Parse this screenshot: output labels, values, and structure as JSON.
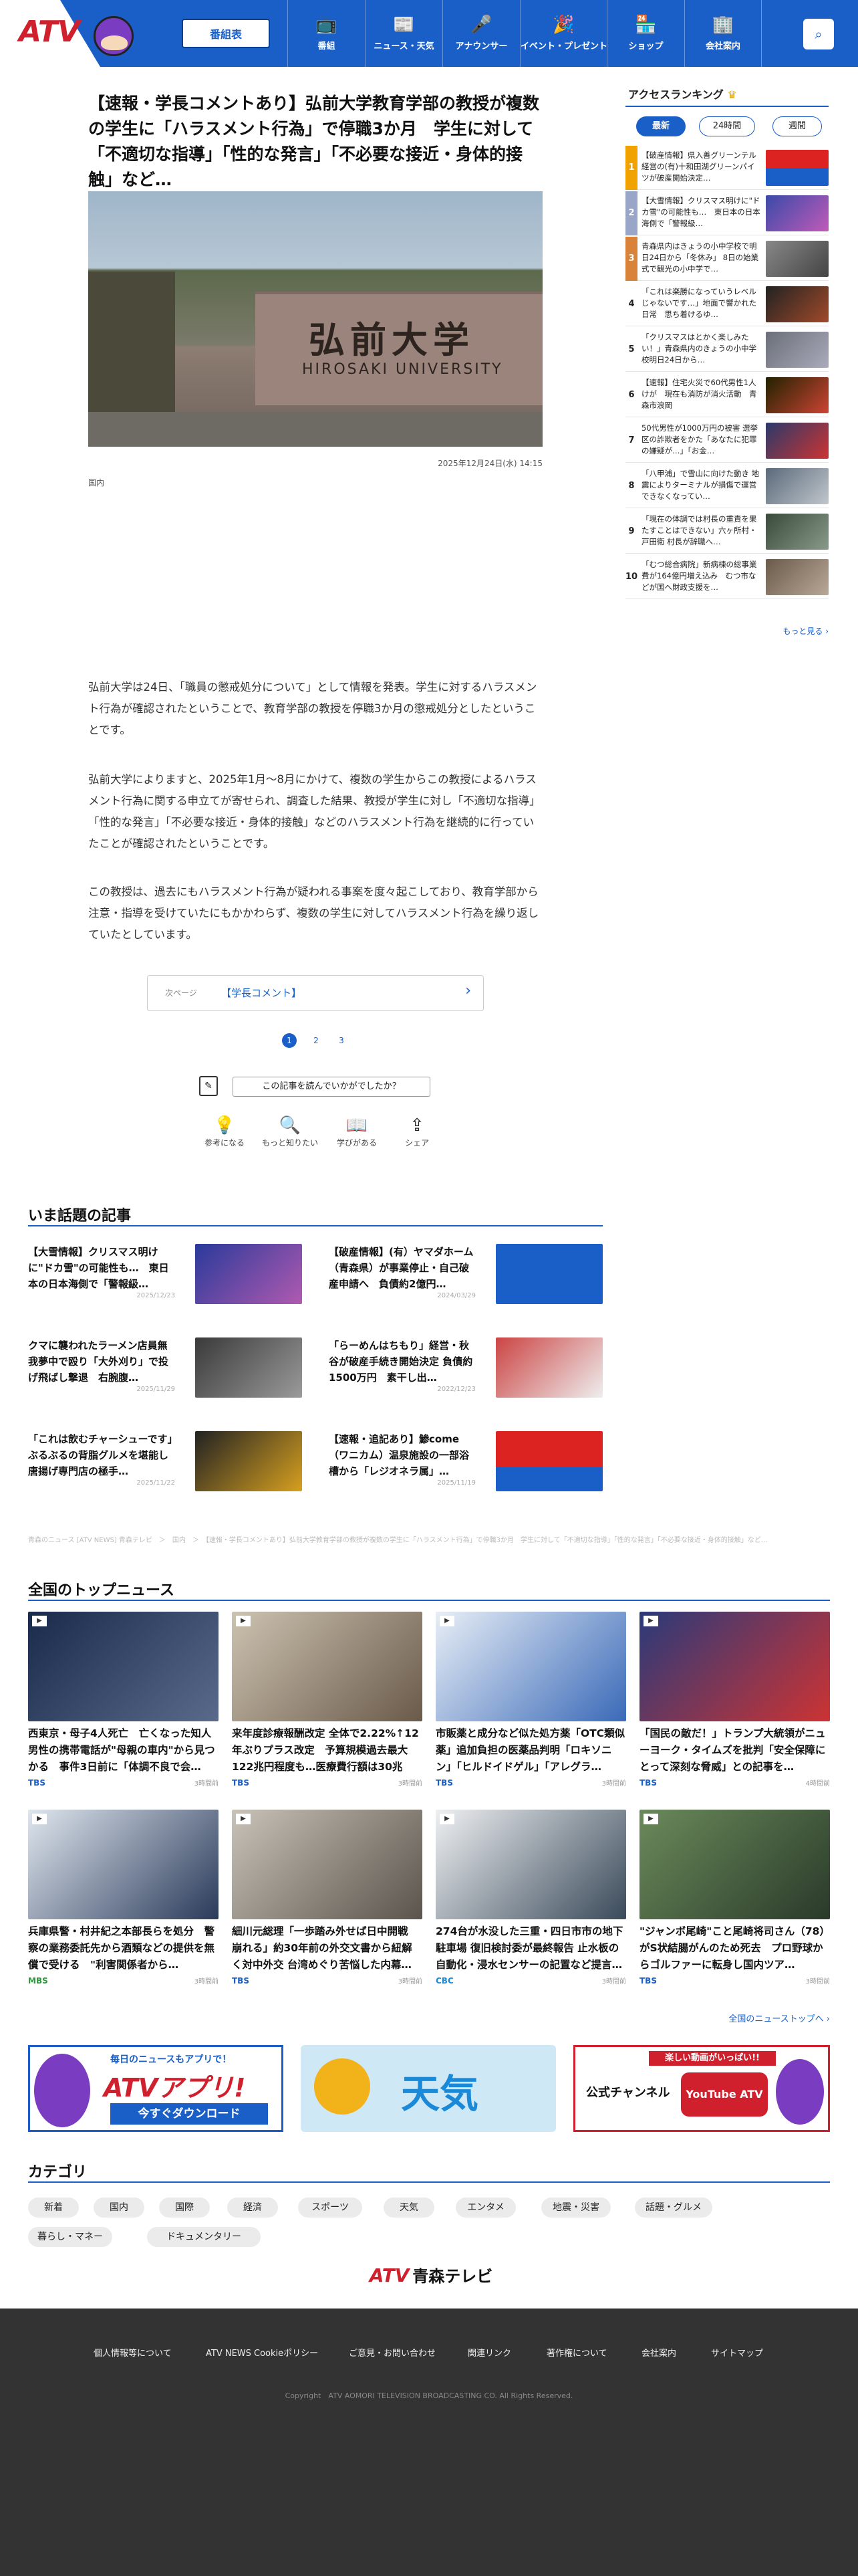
{
  "header": {
    "logo": "ATV",
    "program_button": "番組表",
    "nav": [
      {
        "label": "番組",
        "icon": "tv-icon"
      },
      {
        "label": "ニュース・天気",
        "icon": "news-icon"
      },
      {
        "label": "アナウンサー",
        "icon": "announcer-icon"
      },
      {
        "label": "イベント・プレゼント",
        "icon": "event-icon"
      },
      {
        "label": "ショップ",
        "icon": "shop-icon"
      },
      {
        "label": "会社案内",
        "icon": "company-icon"
      }
    ]
  },
  "article": {
    "title": "【速報・学長コメントあり】弘前大学教育学部の教授が複数の学生に「ハラスメント行為」で停職3か月　学生に対して「不適切な指導」「性的な発言」「不必要な接近・身体的接触」など…",
    "date": "2025年12月24日(水) 14:15",
    "category": "国内",
    "sign_text": "弘前大学",
    "sign_sub": "HIROSAKI UNIVERSITY",
    "paragraphs": [
      "弘前大学は24日、「職員の懲戒処分について」として情報を発表。学生に対するハラスメント行為が確認されたということで、教育学部の教授を停職3か月の懲戒処分としたということです。",
      "弘前大学によりますと、2025年1月～8月にかけて、複数の学生からこの教授によるハラスメント行為に関する申立てが寄せられ、調査した結果、教授が学生に対し「不適切な指導」「性的な発言」「不必要な接近・身体的接触」などのハラスメント行為を継続的に行っていたことが確認されたということです。",
      "この教授は、過去にもハラスメント行為が疑われる事案を度々起こしており、教育学部から注意・指導を受けていたにもかかわらず、複数の学生に対してハラスメント行為を繰り返していたとしています。"
    ],
    "next_label": "次ページ",
    "next_link": "【学長コメント】",
    "pages": [
      "1",
      "2",
      "3"
    ],
    "feedback_question": "この記事を読んでいかがでしたか？",
    "reactions": [
      {
        "label": "参考になる",
        "icon": "bulb-icon"
      },
      {
        "label": "もっと知りたい",
        "icon": "magnifier-icon"
      },
      {
        "label": "学びがある",
        "icon": "book-icon"
      },
      {
        "label": "シェア",
        "icon": "share-icon"
      }
    ]
  },
  "ranking": {
    "title": "アクセスランキング",
    "tabs": [
      "最新",
      "24時間",
      "週間"
    ],
    "items": [
      {
        "rank": "1",
        "text": "【破産情報】県入善グリーンテル経営の(有)十和田湖グリーンパイツが破産開始決定…"
      },
      {
        "rank": "2",
        "text": "【大雪情報】クリスマス明けに\"ドカ雪\"の可能性も…　東日本の日本海側で「警報級…"
      },
      {
        "rank": "3",
        "text": "青森県内はきょうの小中学校で明日24日から「冬休み」 8日の始業式で観光の小中学で…"
      },
      {
        "rank": "4",
        "text": "「これは楽勝になっていうレベルじゃないです…」地面で響かれた日常　思ち着けるゆ…"
      },
      {
        "rank": "5",
        "text": "「クリスマスはとかく楽しみたい！」青森県内のきょうの小中学校明日24日から…"
      },
      {
        "rank": "6",
        "text": "【速報】住宅火災で60代男性1人けが　現在も消防が消火活動　青森市浪岡"
      },
      {
        "rank": "7",
        "text": "50代男性が1000万円の被害 選挙区の詐欺者をかた「あなたに犯罪の嫌疑が…」「お金…"
      },
      {
        "rank": "8",
        "text": "「八甲浦」で雪山に向けた動き 地震によりターミナルが損傷で運営できなくなってい…"
      },
      {
        "rank": "9",
        "text": "「現在の体調では村長の重責を果たすことはできない」六ヶ所村・戸田衛 村長が辞職へ…"
      },
      {
        "rank": "10",
        "text": "「むつ総合病院」新病棟の総事業費が164億円増え込み　むつ市などが国へ財政支援を…"
      }
    ],
    "more": "もっと見る ›"
  },
  "related": {
    "title": "いま話題の記事",
    "items": [
      {
        "text": "【大雪情報】クリスマス明けに\"ドカ雪\"の可能性も…　東日本の日本海側で「警報級…",
        "date": "2025/12/23"
      },
      {
        "text": "【破産情報】(有）ヤマダホーム（青森県）が事業停止・自己破産申請へ　負債約2億円…",
        "date": "2024/03/29"
      },
      {
        "text": "クマに襲われたラーメン店員無我夢中で殴り「大外刈り」で投げ飛ばし撃退　右腕腹…",
        "date": "2025/11/29"
      },
      {
        "text": "「らーめんはちもり」経営・秋谷が破産手続き開始決定 負債約1500万円　素干し出…",
        "date": "2022/12/23"
      },
      {
        "text": "「これは飲むチャーシューです」ぶるぶるの背脂グルメを堪能し唐揚げ専門店の極手…",
        "date": "2025/11/22"
      },
      {
        "text": "【速報・追記あり】鯵come（ワニカム）温泉施設の一部浴槽から「レジオネラ属」…",
        "date": "2025/11/19"
      }
    ]
  },
  "breadcrumb": "青森のニュース [ATV NEWS] 青森テレビ　＞　国内　＞　【速報・学長コメントあり】弘前大学教育学部の教授が複数の学生に「ハラスメント行為」で停職3か月　学生に対して「不適切な指導」「性的な発言」「不必要な接近・身体的接触」など…",
  "top_news": {
    "title": "全国のトップニュース",
    "items": [
      {
        "text": "西東京・母子4人死亡　亡くなった知人男性の携帯電話が\"母親の車内\"から見つかる　事件3日前に「体調不良で会…",
        "source": "TBS",
        "time": "3時間前"
      },
      {
        "text": "来年度診療報酬改定 全体で2.22%↑12年ぶりプラス改定　予算規模過去最大122兆円程度も…医療費行額は30兆円…",
        "source": "TBS",
        "time": "3時間前"
      },
      {
        "text": "市販薬と成分など似た処方薬「OTC類似薬」追加負担の医薬品判明「ロキソニン」「ヒルドイドゲル」「アレグラ…",
        "source": "TBS",
        "time": "3時間前"
      },
      {
        "text": "「国民の敵だ！」トランプ大統領がニューヨーク・タイムズを批判「安全保障にとって深刻な脅威」との記事を…",
        "source": "TBS",
        "time": "4時間前"
      },
      {
        "text": "兵庫県警・村井紀之本部長らを処分　警察の業務委託先から酒類などの提供を無償で受ける　\"利害関係者から…",
        "source": "MBS",
        "time": "3時間前"
      },
      {
        "text": "細川元総理「一歩踏み外せば日中開戦　崩れる」約30年前の外交文書から紐解く対中外交 台湾めぐり苦悩した内幕…",
        "source": "TBS",
        "time": "3時間前"
      },
      {
        "text": "274台が水没した三重・四日市市の地下駐車場 復旧検討委が最終報告 止水板の自動化・浸水センサーの記置など提言…",
        "source": "CBC",
        "time": "3時間前"
      },
      {
        "text": "\"ジャンボ尾崎\"こと尾崎将司さん（78）がS状結腸がんのため死去　プロ野球からゴルファーに転身し国内ツア…",
        "source": "TBS",
        "time": "3時間前"
      }
    ],
    "more": "全国のニューストップへ ›"
  },
  "banners": [
    {
      "top": "毎日のニュースもアプリで！",
      "main": "ATVアプリ!",
      "sub": "今すぐダウンロード"
    },
    {
      "main": "天気"
    },
    {
      "top": "楽しい動画がいっぱい!!",
      "main": "公式チャンネル",
      "sub": "YouTube ATV"
    }
  ],
  "categories": {
    "title": "カテゴリ",
    "items": [
      "新着",
      "国内",
      "国際",
      "経済",
      "スポーツ",
      "天気",
      "エンタメ",
      "地震・災害",
      "話題・グルメ",
      "暮らし・マネー",
      "ドキュメンタリー"
    ]
  },
  "footer_logo": {
    "mark": "ATV",
    "name": "青森テレビ"
  },
  "footer": {
    "links": [
      "個人情報等について",
      "ATV NEWS Cookieポリシー",
      "ご意見・お問い合わせ",
      "関連リンク",
      "著作権について",
      "会社案内",
      "サイトマップ"
    ],
    "copyright": "Copyright　ATV AOMORI TELEVISION BROADCASTING CO. All Rights Reserved."
  },
  "colors": {
    "brand_blue": "#1a5fc8",
    "brand_red": "#d0202e",
    "footer_bg": "#333333"
  }
}
